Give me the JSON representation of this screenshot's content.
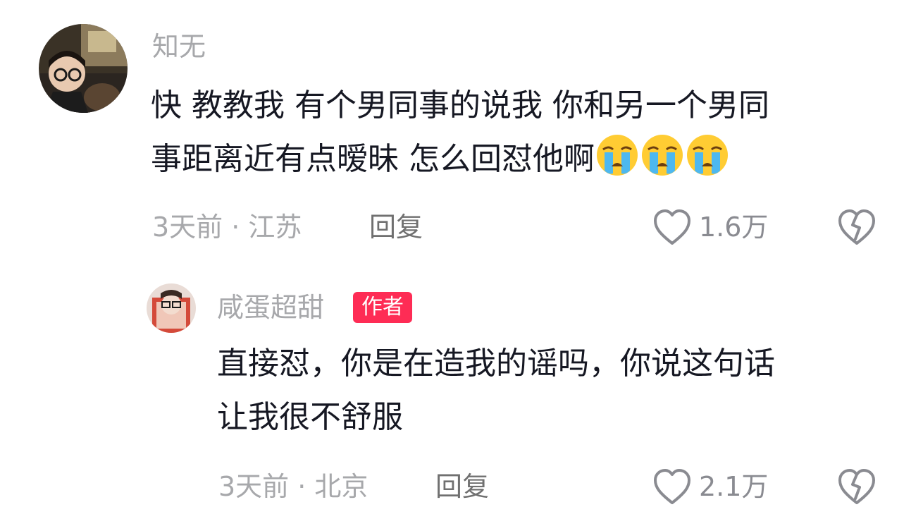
{
  "comments": [
    {
      "username": "知无",
      "text_line1": "快 教教我 有个男同事的说我 你和另一个男同",
      "text_line2": "事距离近有点暧昧 怎么回怼他啊",
      "emojis": [
        "crying-face-emoji",
        "crying-face-emoji",
        "crying-face-emoji"
      ],
      "time_location": "3天前 · 江苏",
      "reply_label": "回复",
      "likes": "1.6万"
    }
  ],
  "reply": {
    "username": "咸蛋超甜",
    "badge": "作者",
    "text_line1": "直接怼，你是在造我的谣吗，你说这句话",
    "text_line2": "让我很不舒服",
    "time_location": "3天前 · 北京",
    "reply_label": "回复",
    "likes": "2.1万"
  },
  "colors": {
    "muted_text": "#a7a8ab",
    "body_text": "#161823",
    "badge_bg": "#fe2c55",
    "icon_stroke": "#8a8b91"
  }
}
